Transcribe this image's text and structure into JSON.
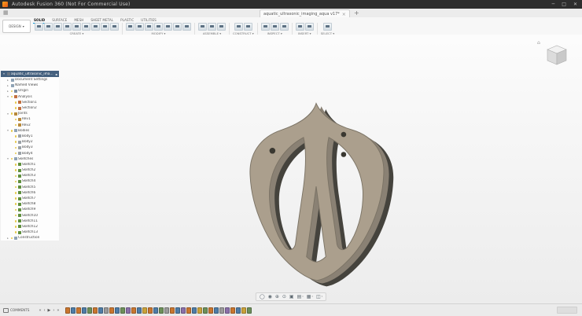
{
  "titlebar": {
    "app_title": "Autodesk Fusion 360 (Not For Commercial Use)",
    "minimize": "─",
    "maximize": "□",
    "close": "✕"
  },
  "tabbar": {
    "document_tab": "aquatic_ultrasonic_imaging_aqua v17*",
    "tab_close": "×",
    "new_tab": "+",
    "data_panel_icon": "▦"
  },
  "ribbon": {
    "workspace_selector": "DESIGN",
    "caret": "▾",
    "workspace_tabs": [
      {
        "label": "SOLID",
        "active": true
      },
      {
        "label": "SURFACE",
        "active": false
      },
      {
        "label": "MESH",
        "active": false
      },
      {
        "label": "SHEET METAL",
        "active": false
      },
      {
        "label": "PLASTIC",
        "active": false
      },
      {
        "label": "UTILITIES",
        "active": false
      }
    ],
    "groups": [
      {
        "label": "CREATE",
        "icons": [
          "new-component",
          "create-sketch",
          "create-form",
          "extrude",
          "revolve",
          "sweep",
          "loft",
          "hole",
          "pattern"
        ]
      },
      {
        "label": "MODIFY",
        "icons": [
          "press-pull",
          "fillet",
          "shell",
          "combine",
          "split-body",
          "align",
          "change-parameters"
        ]
      },
      {
        "label": "ASSEMBLE",
        "icons": [
          "new-component",
          "joint",
          "rigid-group"
        ]
      },
      {
        "label": "CONSTRUCT",
        "icons": [
          "offset-plane",
          "axis"
        ]
      },
      {
        "label": "INSPECT",
        "icons": [
          "measure",
          "interference",
          "section-analysis"
        ]
      },
      {
        "label": "INSERT",
        "icons": [
          "insert-derive",
          "insert-mesh"
        ]
      },
      {
        "label": "SELECT",
        "icons": [
          "select"
        ]
      }
    ]
  },
  "browser": {
    "items": [
      {
        "label": "aquatic_ultrasonic_imaging_aqua v17",
        "type": "document",
        "depth": 0,
        "children": "open",
        "bulb": false,
        "selected": true
      },
      {
        "label": "Document Settings",
        "type": "folder",
        "depth": 1,
        "children": "closed",
        "bulb": false,
        "selected": false
      },
      {
        "label": "Named Views",
        "type": "folder",
        "depth": 1,
        "children": "closed",
        "bulb": false,
        "selected": false
      },
      {
        "label": "Origin",
        "type": "origin",
        "depth": 1,
        "children": "closed",
        "bulb": true,
        "selected": false
      },
      {
        "label": "Analysis",
        "type": "analysis",
        "depth": 1,
        "children": "open",
        "bulb": true,
        "selected": false
      },
      {
        "label": "Section1",
        "type": "analysis",
        "depth": 2,
        "children": null,
        "bulb": true,
        "selected": false
      },
      {
        "label": "Section2",
        "type": "analysis",
        "depth": 2,
        "children": null,
        "bulb": true,
        "selected": false
      },
      {
        "label": "Joints",
        "type": "joint",
        "depth": 1,
        "children": "open",
        "bulb": true,
        "selected": false
      },
      {
        "label": "Rev1",
        "type": "joint",
        "depth": 2,
        "children": null,
        "bulb": true,
        "selected": false
      },
      {
        "label": "Rev2",
        "type": "joint",
        "depth": 2,
        "children": null,
        "bulb": true,
        "selected": false
      },
      {
        "label": "Bodies",
        "type": "folder",
        "depth": 1,
        "children": "open",
        "bulb": true,
        "selected": false
      },
      {
        "label": "Body1",
        "type": "body",
        "depth": 2,
        "children": null,
        "bulb": true,
        "selected": false
      },
      {
        "label": "Body2",
        "type": "body",
        "depth": 2,
        "children": null,
        "bulb": true,
        "selected": false
      },
      {
        "label": "Body3",
        "type": "body",
        "depth": 2,
        "children": null,
        "bulb": true,
        "selected": false
      },
      {
        "label": "Body4",
        "type": "body",
        "depth": 2,
        "children": null,
        "bulb": true,
        "selected": false
      },
      {
        "label": "Sketches",
        "type": "folder",
        "depth": 1,
        "children": "open",
        "bulb": true,
        "selected": false
      },
      {
        "label": "Sketch1",
        "type": "sketch",
        "depth": 2,
        "children": null,
        "bulb": true,
        "selected": false
      },
      {
        "label": "Sketch2",
        "type": "sketch",
        "depth": 2,
        "children": null,
        "bulb": true,
        "selected": false
      },
      {
        "label": "Sketch3",
        "type": "sketch",
        "depth": 2,
        "children": null,
        "bulb": true,
        "selected": false
      },
      {
        "label": "Sketch4",
        "type": "sketch",
        "depth": 2,
        "children": null,
        "bulb": true,
        "selected": false
      },
      {
        "label": "Sketch5",
        "type": "sketch",
        "depth": 2,
        "children": null,
        "bulb": true,
        "selected": false
      },
      {
        "label": "Sketch6",
        "type": "sketch",
        "depth": 2,
        "children": null,
        "bulb": true,
        "selected": false
      },
      {
        "label": "Sketch7",
        "type": "sketch",
        "depth": 2,
        "children": null,
        "bulb": true,
        "selected": false
      },
      {
        "label": "Sketch8",
        "type": "sketch",
        "depth": 2,
        "children": null,
        "bulb": true,
        "selected": false
      },
      {
        "label": "Sketch9",
        "type": "sketch",
        "depth": 2,
        "children": null,
        "bulb": true,
        "selected": false
      },
      {
        "label": "Sketch10",
        "type": "sketch",
        "depth": 2,
        "children": null,
        "bulb": true,
        "selected": false
      },
      {
        "label": "Sketch11",
        "type": "sketch",
        "depth": 2,
        "children": null,
        "bulb": true,
        "selected": false
      },
      {
        "label": "Sketch12",
        "type": "sketch",
        "depth": 2,
        "children": null,
        "bulb": true,
        "selected": false
      },
      {
        "label": "Sketch13",
        "type": "sketch",
        "depth": 2,
        "children": null,
        "bulb": true,
        "selected": false
      },
      {
        "label": "Construction",
        "type": "folder",
        "depth": 1,
        "children": "closed",
        "bulb": true,
        "selected": false
      }
    ]
  },
  "viewcube": {
    "home_icon": "⌂"
  },
  "navbar": {
    "icons": [
      "orbit",
      "look-at",
      "pan",
      "zoom",
      "fit",
      "display-settings",
      "grid-and-snaps",
      "viewports"
    ]
  },
  "timeline": {
    "comments_label": "COMMENTS",
    "controls": [
      "go-to-start",
      "step-back",
      "play",
      "step-forward",
      "go-to-end"
    ],
    "control_glyphs": {
      "go-to-start": "«",
      "step-back": "‹",
      "play": "▶",
      "step-forward": "›",
      "go-to-end": "»"
    },
    "features": [
      "sketch",
      "extrude",
      "sketch",
      "extrude",
      "fillet",
      "sketch",
      "extrude",
      "combine",
      "sketch",
      "extrude",
      "fillet",
      "hole",
      "sketch",
      "extrude",
      "joint",
      "sketch",
      "extrude",
      "fillet",
      "combine",
      "sketch",
      "extrude",
      "hole",
      "sketch",
      "extrude",
      "joint",
      "fillet",
      "sketch",
      "extrude",
      "combine",
      "hole",
      "sketch",
      "extrude",
      "joint",
      "fillet"
    ]
  },
  "model": {
    "front_color": "#ab9f8d",
    "mid_color": "#8a8174",
    "back_color": "#45433d",
    "edge_color": "#7b7365",
    "hole_color": "#3a3831"
  }
}
